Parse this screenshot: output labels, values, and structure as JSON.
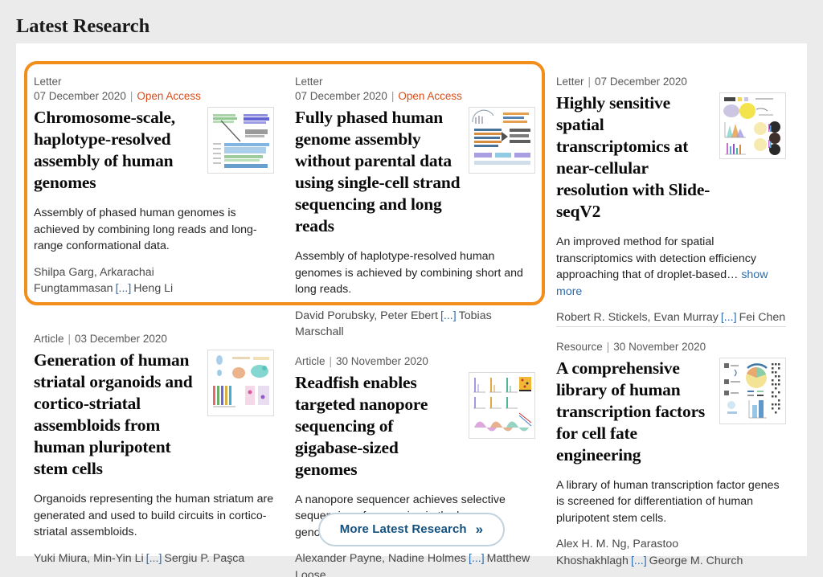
{
  "page": {
    "heading": "Latest Research",
    "accent_color": "#f28f1c",
    "link_color": "#2b6cb0",
    "open_access_color": "#d94d1a"
  },
  "articles": [
    {
      "kind": "Letter",
      "date": "07 December 2020",
      "separator": "|",
      "open_access": "Open Access",
      "meta_two_lines": true,
      "title": "Chromosome-scale, haplotype-resolved assembly of human genomes",
      "description": "Assembly of phased human genomes is achieved by combining long reads and long-range conformational data.",
      "show_more": "",
      "authors_lead": "Shilpa Garg, Arkarachai Fungtammasan",
      "authors_ellipsis": "[...]",
      "authors_last": "Heng Li",
      "thumbnail": "figure-diagram-chromosome"
    },
    {
      "kind": "Letter",
      "date": "07 December 2020",
      "separator": "|",
      "open_access": "Open Access",
      "meta_two_lines": true,
      "title": "Fully phased human genome assembly without parental data using single-cell strand sequencing and long reads",
      "description": "Assembly of haplotype-resolved human genomes is achieved by combining short and long reads.",
      "show_more": "",
      "authors_lead": "David Porubsky, Peter Ebert",
      "authors_ellipsis": "[...]",
      "authors_last": "Tobias Marschall",
      "thumbnail": "figure-diagram-assembly"
    },
    {
      "kind": "Letter",
      "date": "07 December 2020",
      "separator": "|",
      "open_access": "",
      "meta_two_lines": false,
      "title": "Highly sensitive spatial transcriptomics at near-cellular resolution with Slide-seqV2",
      "description": "An improved method for spatial transcriptomics with detection efficiency approaching that of droplet-based…",
      "show_more": "show more",
      "authors_lead": "Robert R. Stickels, Evan Murray",
      "authors_ellipsis": "[...]",
      "authors_last": "Fei Chen",
      "thumbnail": "figure-slideseq"
    },
    {
      "kind": "Article",
      "date": "03 December 2020",
      "separator": "|",
      "open_access": "",
      "meta_two_lines": false,
      "title": "Generation of human striatal organoids and cortico-striatal assembloids from human pluripotent stem cells",
      "description": "Organoids representing the human striatum are generated and used to build circuits in cortico-striatal assembloids.",
      "show_more": "",
      "authors_lead": "Yuki Miura, Min-Yin Li",
      "authors_ellipsis": "[...]",
      "authors_last": "Sergiu P. Paşca",
      "thumbnail": "figure-organoids"
    },
    {
      "kind": "Article",
      "date": "30 November 2020",
      "separator": "|",
      "open_access": "",
      "meta_two_lines": false,
      "title": "Readfish enables targeted nanopore sequencing of gigabase-sized genomes",
      "description": "A nanopore sequencer achieves selective sequencing of any region in the human genome.",
      "show_more": "",
      "authors_lead": "Alexander Payne, Nadine Holmes",
      "authors_ellipsis": "[...]",
      "authors_last": "Matthew Loose",
      "thumbnail": "figure-readfish"
    },
    {
      "kind": "Resource",
      "date": "30 November 2020",
      "separator": "|",
      "open_access": "",
      "meta_two_lines": false,
      "title": "A comprehensive library of human transcription factors for cell fate engineering",
      "description": "A library of human transcription factor genes is screened for differentiation of human pluripotent stem cells.",
      "show_more": "",
      "authors_lead": "Alex H. M. Ng, Parastoo Khoshakhlagh",
      "authors_ellipsis": "[...]",
      "authors_last": "George M. Church",
      "thumbnail": "figure-tf-library"
    }
  ],
  "more_button": {
    "label": "More Latest Research",
    "chevron": "»"
  }
}
